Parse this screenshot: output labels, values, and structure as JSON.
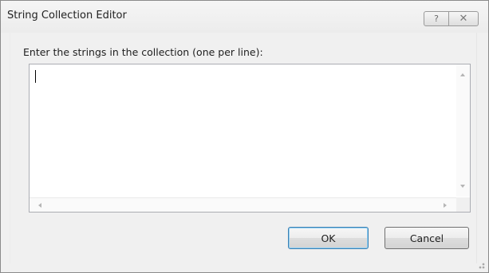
{
  "window": {
    "title": "String Collection Editor",
    "help_glyph": "?",
    "close_glyph": "✕"
  },
  "editor": {
    "prompt": "Enter the strings in the collection (one per line):",
    "value": ""
  },
  "buttons": {
    "ok_label": "OK",
    "cancel_label": "Cancel"
  },
  "colors": {
    "default_button_border": "#3c7fb1",
    "dialog_background": "#f0f0f0"
  }
}
